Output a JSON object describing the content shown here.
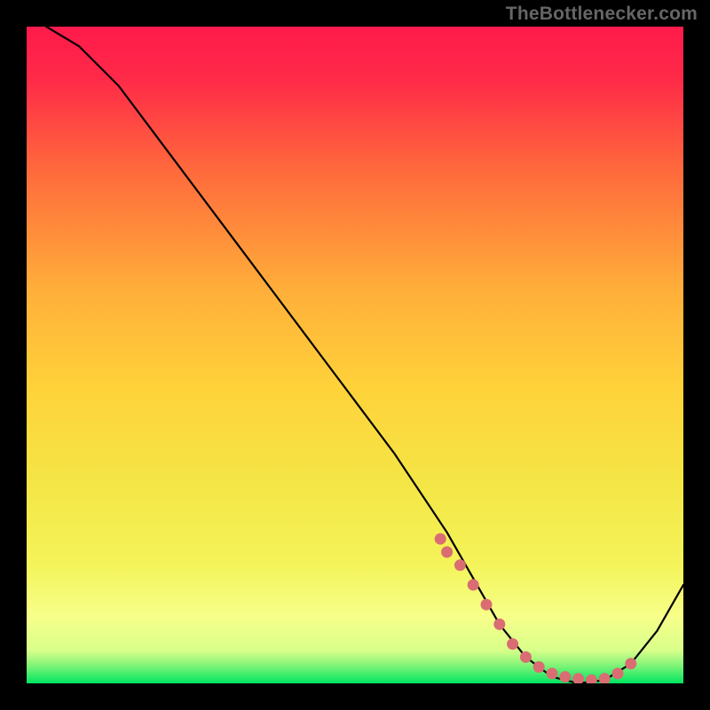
{
  "watermark": "TheBottlenecker.com",
  "chart_data": {
    "type": "line",
    "title": "",
    "xlabel": "",
    "ylabel": "",
    "xlim": [
      0,
      100
    ],
    "ylim": [
      0,
      100
    ],
    "background_gradient": {
      "top": "#ff1a4b",
      "upper_mid": "#ff7a3a",
      "mid": "#ffd23a",
      "lower_mid": "#f4f45a",
      "lower": "#f6ff8a",
      "bottom": "#00e560"
    },
    "series": [
      {
        "name": "bottleneck-curve",
        "color": "#000000",
        "x": [
          3,
          8,
          14,
          20,
          26,
          32,
          38,
          44,
          50,
          56,
          60,
          64,
          68,
          72,
          76,
          80,
          84,
          88,
          92,
          96,
          100
        ],
        "y": [
          100,
          97,
          91,
          83,
          75,
          67,
          59,
          51,
          43,
          35,
          29,
          23,
          16,
          9,
          4,
          1,
          0,
          0.5,
          3,
          8,
          15
        ]
      }
    ],
    "highlight_points": {
      "color": "#d96d72",
      "x": [
        63,
        64,
        66,
        68,
        70,
        72,
        74,
        76,
        78,
        80,
        82,
        84,
        86,
        88,
        90,
        92
      ],
      "y": [
        22,
        20,
        18,
        15,
        12,
        9,
        6,
        4,
        2.5,
        1.5,
        1,
        0.7,
        0.5,
        0.7,
        1.5,
        3
      ]
    }
  }
}
